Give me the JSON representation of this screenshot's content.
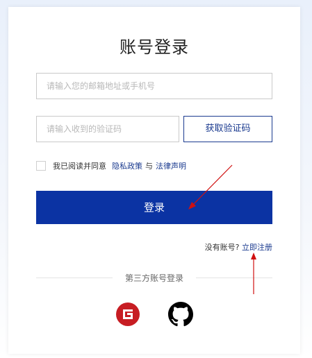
{
  "title": "账号登录",
  "email_input": {
    "placeholder": "请输入您的邮箱地址或手机号",
    "value": ""
  },
  "code_input": {
    "placeholder": "请输入收到的验证码",
    "value": ""
  },
  "get_code_label": "获取验证码",
  "agreement": {
    "prefix": "我已阅读并同意",
    "privacy": "隐私政策",
    "and": "与",
    "legal": "法律声明"
  },
  "login_label": "登录",
  "register": {
    "prompt": "没有账号?",
    "link": "立即注册"
  },
  "third_party_label": "第三方账号登录",
  "social": [
    "gitee-icon",
    "github-icon"
  ],
  "colors": {
    "primary": "#0b33a3",
    "link": "#1a3a8f",
    "gitee": "#c71d23",
    "github": "#000000",
    "annotation_arrow": "#d01010"
  }
}
